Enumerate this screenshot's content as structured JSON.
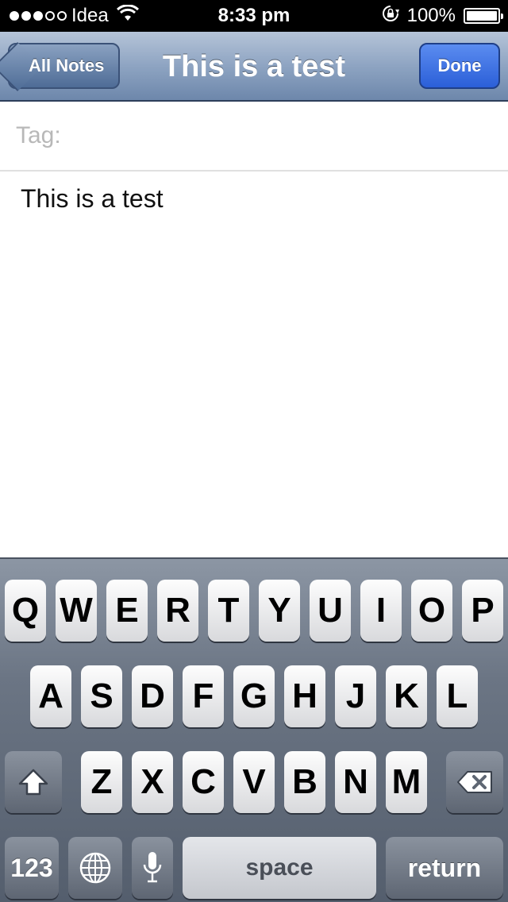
{
  "status_bar": {
    "carrier": "Idea",
    "time": "8:33 pm",
    "battery": "100%",
    "battery_level": 1.0,
    "signal_bars_filled": 3,
    "signal_bars_total": 5
  },
  "nav": {
    "back_label": "All Notes",
    "title": "This is a test",
    "done_label": "Done"
  },
  "tag": {
    "placeholder": "Tag:",
    "value": ""
  },
  "note": {
    "text": "This is a test"
  },
  "keyboard": {
    "row1": [
      "Q",
      "W",
      "E",
      "R",
      "T",
      "Y",
      "U",
      "I",
      "O",
      "P"
    ],
    "row2": [
      "A",
      "S",
      "D",
      "F",
      "G",
      "H",
      "J",
      "K",
      "L"
    ],
    "row3": [
      "Z",
      "X",
      "C",
      "V",
      "B",
      "N",
      "M"
    ],
    "numbers_label": "123",
    "space_label": "space",
    "return_label": "return"
  },
  "icons": {
    "wifi": "wifi-icon",
    "rotation_lock": "rotation-lock-icon",
    "battery": "battery-icon",
    "shift": "shift-icon",
    "delete": "delete-icon",
    "globe": "globe-icon",
    "microphone": "microphone-icon"
  },
  "colors": {
    "nav_bar": "#8ea4c2",
    "done_button": "#2b5fd8",
    "keyboard_bg": "#6b7584"
  }
}
